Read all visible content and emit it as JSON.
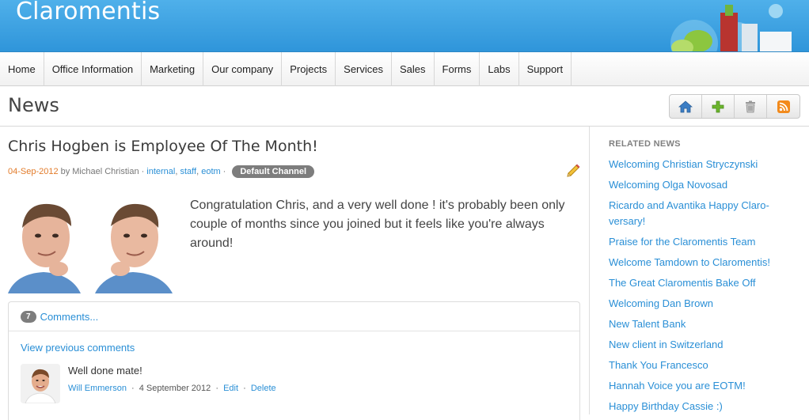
{
  "app": {
    "brand": "Claromentis"
  },
  "nav": {
    "items": [
      "Home",
      "Office Information",
      "Marketing",
      "Our company",
      "Projects",
      "Services",
      "Sales",
      "Forms",
      "Labs",
      "Support"
    ]
  },
  "page": {
    "title": "News"
  },
  "toolbar": {
    "icons": [
      "home-icon",
      "add-icon",
      "trash-icon",
      "rss-icon"
    ]
  },
  "article": {
    "title": "Chris Hogben is Employee Of The Month!",
    "date": "04-Sep-2012",
    "by": "by",
    "author": "Michael Christian",
    "tags": [
      "internal",
      "staff",
      "eotm"
    ],
    "channel": "Default Channel",
    "body": "Congratulation Chris, and a very well done ! it's probably been only couple of months since you joined but it feels like you're always around!"
  },
  "comments": {
    "count": "7",
    "label": "Comments...",
    "view_previous": "View previous comments",
    "items": [
      {
        "text": "Well done mate!",
        "author": "Will Emmerson",
        "date": "4 September 2012",
        "edit": "Edit",
        "delete": "Delete"
      }
    ]
  },
  "sidebar": {
    "title": "RELATED NEWS",
    "items": [
      "Welcoming Christian Stryczynski",
      "Welcoming Olga Novosad",
      "Ricardo and Avantika Happy Claro-versary!",
      "Praise for the Claromentis Team",
      "Welcome Tamdown to Claromentis!",
      "The Great Claromentis Bake Off",
      "Welcoming Dan Brown",
      "New Talent Bank",
      "New client in Switzerland",
      "Thank You Francesco",
      "Hannah Voice you are EOTM!",
      "Happy Birthday Cassie :)"
    ]
  },
  "colors": {
    "header_blue": "#3a9fe0",
    "link": "#2a8fd6",
    "date_orange": "#e27b2a",
    "badge_gray": "#7d7d7d"
  }
}
